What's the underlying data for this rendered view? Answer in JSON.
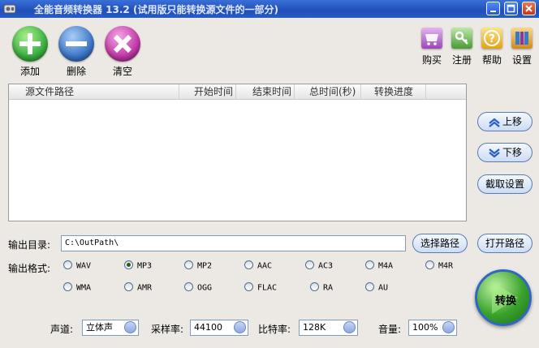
{
  "window": {
    "title": "全能音频转换器 13.2 (试用版只能转换源文件的一部分)"
  },
  "toolbar": {
    "add_label": "添加",
    "delete_label": "删除",
    "clear_label": "清空",
    "buy_label": "购买",
    "register_label": "注册",
    "help_label": "帮助",
    "settings_label": "设置"
  },
  "file_list": {
    "columns": [
      "源文件路径",
      "开始时间",
      "结束时间",
      "总时间(秒)",
      "转换进度"
    ],
    "rows": []
  },
  "side": {
    "move_up_label": "上移",
    "move_down_label": "下移",
    "trim_settings_label": "截取设置",
    "open_path_label": "打开路径"
  },
  "output": {
    "dir_label": "输出目录:",
    "dir_value": "C:\\OutPath\\",
    "choose_path_label": "选择路径",
    "format_label": "输出格式:",
    "formats": [
      "WAV",
      "MP3",
      "MP2",
      "AAC",
      "AC3",
      "M4A",
      "M4R",
      "WMA",
      "AMR",
      "OGG",
      "FLAC",
      "RA",
      "AU"
    ],
    "selected_format": "MP3"
  },
  "audio": {
    "channel_label": "声道:",
    "channel_value": "立体声",
    "sample_rate_label": "采样率:",
    "sample_rate_value": "44100",
    "bitrate_label": "比特率:",
    "bitrate_value": "128K",
    "volume_label": "音量:",
    "volume_value": "100%"
  },
  "convert_label": "转换",
  "colors": {
    "titlebar": "#2558c8",
    "add": "#3cb043",
    "delete": "#3e78c8",
    "clear": "#c23aa8",
    "convert": "#3aa22c"
  }
}
